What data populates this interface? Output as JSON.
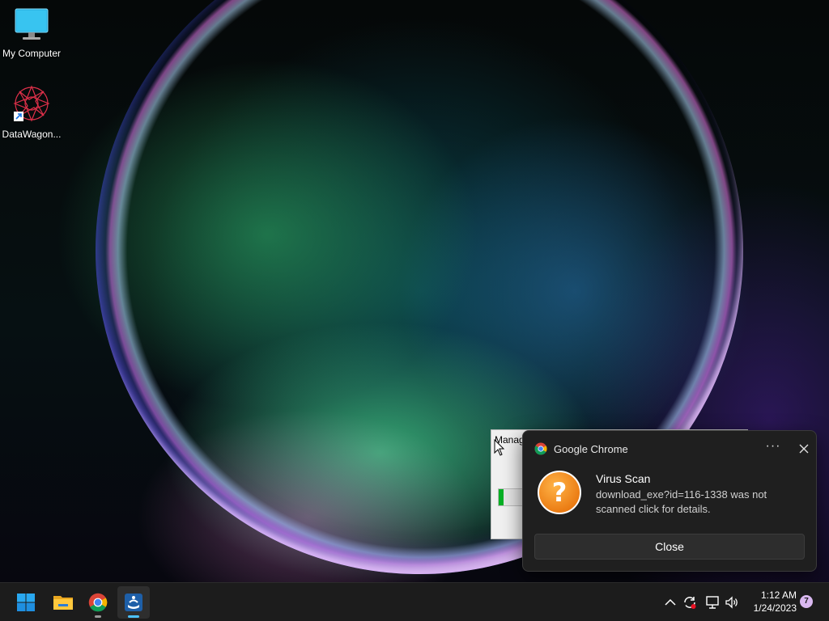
{
  "desktop": {
    "icons": [
      {
        "label": "My Computer",
        "icon": "monitor-icon"
      },
      {
        "label": "DataWagon...",
        "icon": "datawagon-app-icon"
      }
    ]
  },
  "background_window": {
    "title": "Manag",
    "progress": 0.05
  },
  "toast": {
    "app_name": "Google Chrome",
    "more_label": "···",
    "title": "Virus Scan",
    "body": "download_exe?id=116-1338 was not scanned click for details.",
    "button_label": "Close",
    "hero_icon": "question-mark-icon",
    "hero_color": "#f0901e"
  },
  "taskbar": {
    "apps": [
      {
        "name": "Start",
        "icon": "windows-start-icon"
      },
      {
        "name": "File Explorer",
        "icon": "folder-icon"
      },
      {
        "name": "Google Chrome",
        "icon": "chrome-icon"
      },
      {
        "name": "App",
        "icon": "app-icon"
      }
    ],
    "tray": {
      "time": "1:12 AM",
      "date": "1/24/2023",
      "notification_count": "7"
    }
  },
  "colors": {
    "accent": "#0078d4",
    "taskbar": "#1c1c1c",
    "toast_bg": "#1f1f1f"
  }
}
